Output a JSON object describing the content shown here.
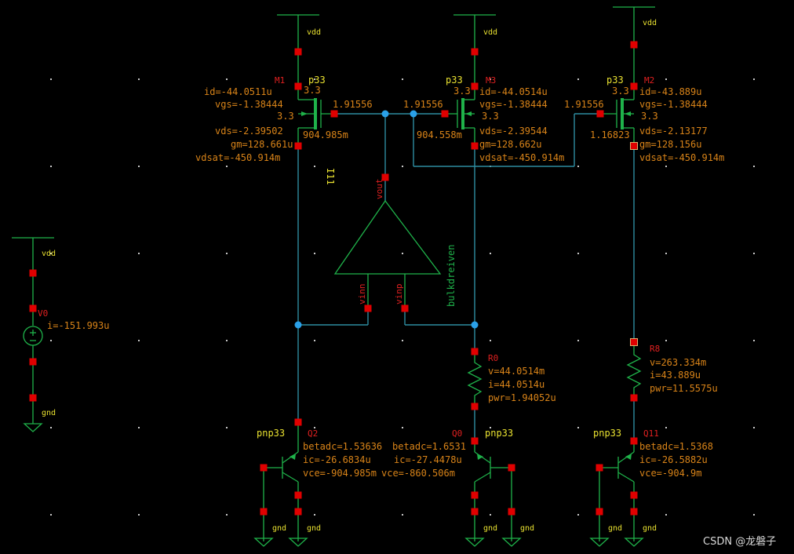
{
  "nets": {
    "vdd": "vdd",
    "gnd": "gnd"
  },
  "m1": {
    "name": "M1",
    "model": "p33",
    "w": "3.3",
    "l": "3.3",
    "id": "id=-44.0511u",
    "vgs": "vgs=-1.38444",
    "vds": "vds=-2.39502",
    "gm": "gm=128.661u",
    "vdsat": "vdsat=-450.914m"
  },
  "m3": {
    "name": "M3",
    "model": "p33",
    "w": "3.3",
    "l": "3.3",
    "id": "id=-44.0514u",
    "vgs": "vgs=-1.38444",
    "vds": "vds=-2.39544",
    "gm": "gm=128.662u",
    "vdsat": "vdsat=-450.914m"
  },
  "m2": {
    "name": "M2",
    "model": "p33",
    "w": "3.3",
    "l": "3.3",
    "id": "id=-43.889u",
    "vgs": "vgs=-1.38444",
    "vds": "vds=-2.13177",
    "gm": "gm=128.156u",
    "vdsat": "vdsat=-450.914m"
  },
  "node_voltages": {
    "g1": "1.91556",
    "g3": "1.91556",
    "g2": "1.91556",
    "d1": "904.985m",
    "d3": "904.558m",
    "d2": "1.16823"
  },
  "opamp": {
    "instance": "I11",
    "cell": "bulkdreiven",
    "pin_out": "vout",
    "pin_n": "vinn",
    "pin_p": "vinp"
  },
  "v0": {
    "name": "V0",
    "i": "i=-151.993u"
  },
  "r0": {
    "name": "R0",
    "v": "v=44.0514m",
    "i": "i=44.0514u",
    "pwr": "pwr=1.94052u"
  },
  "r8": {
    "name": "R8",
    "v": "v=263.334m",
    "i": "i=43.889u",
    "pwr": "pwr=11.5575u"
  },
  "q2": {
    "name": "Q2",
    "model": "pnp33",
    "betadc": "betadc=1.53636",
    "ic": "ic=-26.6834u",
    "vce": "vce=-904.985m"
  },
  "q0": {
    "name": "Q0",
    "model": "pnp33",
    "betadc": "betadc=1.6531",
    "ic": "ic=-27.4478u",
    "vce": "vce=-860.506m"
  },
  "q11": {
    "name": "Q11",
    "model": "pnp33",
    "betadc": "betadc=1.5368",
    "ic": "ic=-26.5882u",
    "vce": "vce=-904.9m"
  },
  "watermark": "CSDN @龙磐子",
  "colors": {
    "background": "#000000",
    "wire": "#2d8ca0",
    "symbol": "#1fb24a",
    "pin": "#e00000",
    "annotation": "#d88318",
    "instance_name": "#e02020",
    "model_name": "#e8e030"
  }
}
